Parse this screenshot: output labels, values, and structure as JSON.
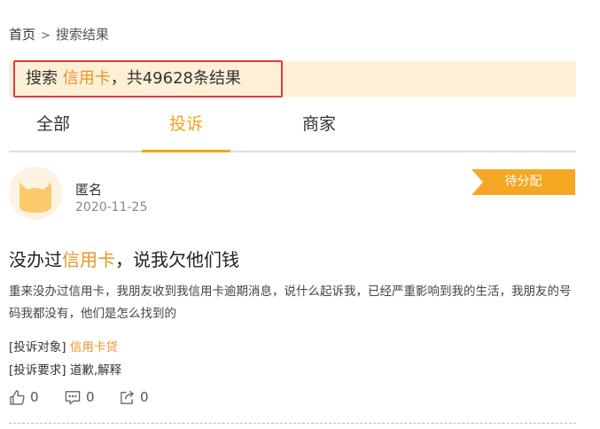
{
  "breadcrumb": {
    "home": "首页",
    "separator": ">",
    "current": "搜索结果"
  },
  "search": {
    "prefix": "搜索",
    "keyword": "信用卡",
    "suffix_prefix": "，共",
    "count": "49628",
    "suffix": "条结果"
  },
  "tabs": [
    {
      "label": "全部",
      "active": false
    },
    {
      "label": "投诉",
      "active": true
    },
    {
      "label": "商家",
      "active": false
    }
  ],
  "post": {
    "user": "匿名",
    "date": "2020-11-25",
    "status": "待分配",
    "title_before": "没办过",
    "title_keyword": "信用卡",
    "title_after": "，说我欠他们钱",
    "body": "重来没办过信用卡，我朋友收到我信用卡逾期消息，说什么起诉我，已经严重影响到我的生活，我朋友的号码我都没有，他们是怎么找到的",
    "target_label": "[投诉对象]",
    "target_keyword": "信用卡",
    "target_rest": "贷",
    "request_label": "[投诉要求]",
    "request_value": "道歉,解释",
    "likes": "0",
    "comments": "0",
    "shares": "0"
  },
  "colors": {
    "accent": "#f2a51a",
    "keyword": "#e8942a",
    "banner": "#fdf0d7",
    "highlight_border": "#e23a3a"
  },
  "icons": [
    "cat-avatar-icon",
    "thumbs-up-icon",
    "comment-icon",
    "share-icon"
  ]
}
